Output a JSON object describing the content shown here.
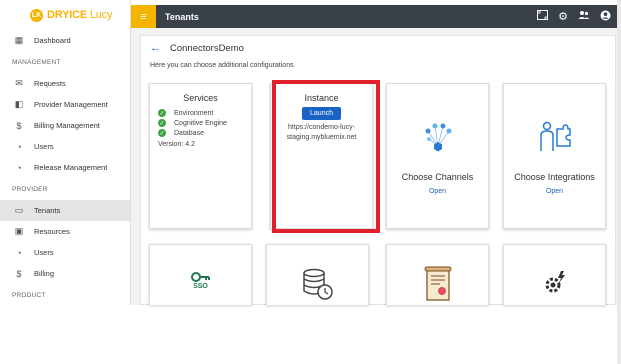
{
  "logo": {
    "mark": "LK",
    "brand": "DRYICE",
    "product": "Lucy"
  },
  "sidebar": {
    "items_top": [
      {
        "label": "Dashboard",
        "icon": "dashboard-icon"
      }
    ],
    "management_label": "MANAGEMENT",
    "management": [
      {
        "label": "Requests",
        "icon": "mail-icon"
      },
      {
        "label": "Provider Management",
        "icon": "window-icon"
      },
      {
        "label": "Billing Management",
        "icon": "dollar-icon"
      },
      {
        "label": "Users",
        "icon": "users-icon"
      },
      {
        "label": "Release Management",
        "icon": "release-icon"
      }
    ],
    "provider_label": "PROVIDER",
    "provider": [
      {
        "label": "Tenants",
        "icon": "clipboard-icon",
        "active": true
      },
      {
        "label": "Resources",
        "icon": "image-icon"
      },
      {
        "label": "Users",
        "icon": "users-icon"
      },
      {
        "label": "Billing",
        "icon": "dollar-icon"
      }
    ],
    "product_label": "PRODUCT"
  },
  "topbar": {
    "title": "Tenants"
  },
  "page": {
    "title": "ConnectorsDemo",
    "subtitle": "Here you can choose additional configurations"
  },
  "services": {
    "title": "Services",
    "items": [
      "Environment",
      "Cognitive Engine",
      "Database"
    ],
    "version": "Version: 4.2"
  },
  "instance": {
    "title": "Instance",
    "launch_label": "Launch",
    "url_line1": "https://condemo-lucy-",
    "url_line2": "staging.mybluemix.net"
  },
  "channels": {
    "title": "Choose Channels",
    "link": "Open"
  },
  "integrations": {
    "title": "Choose Integrations",
    "link": "Open"
  },
  "sso": {
    "label": "SSO"
  },
  "colors": {
    "accent": "#f5b400",
    "topbar": "#3a4047",
    "link": "#1a63c4",
    "highlight": "#e0202a",
    "check": "#3fa142"
  }
}
